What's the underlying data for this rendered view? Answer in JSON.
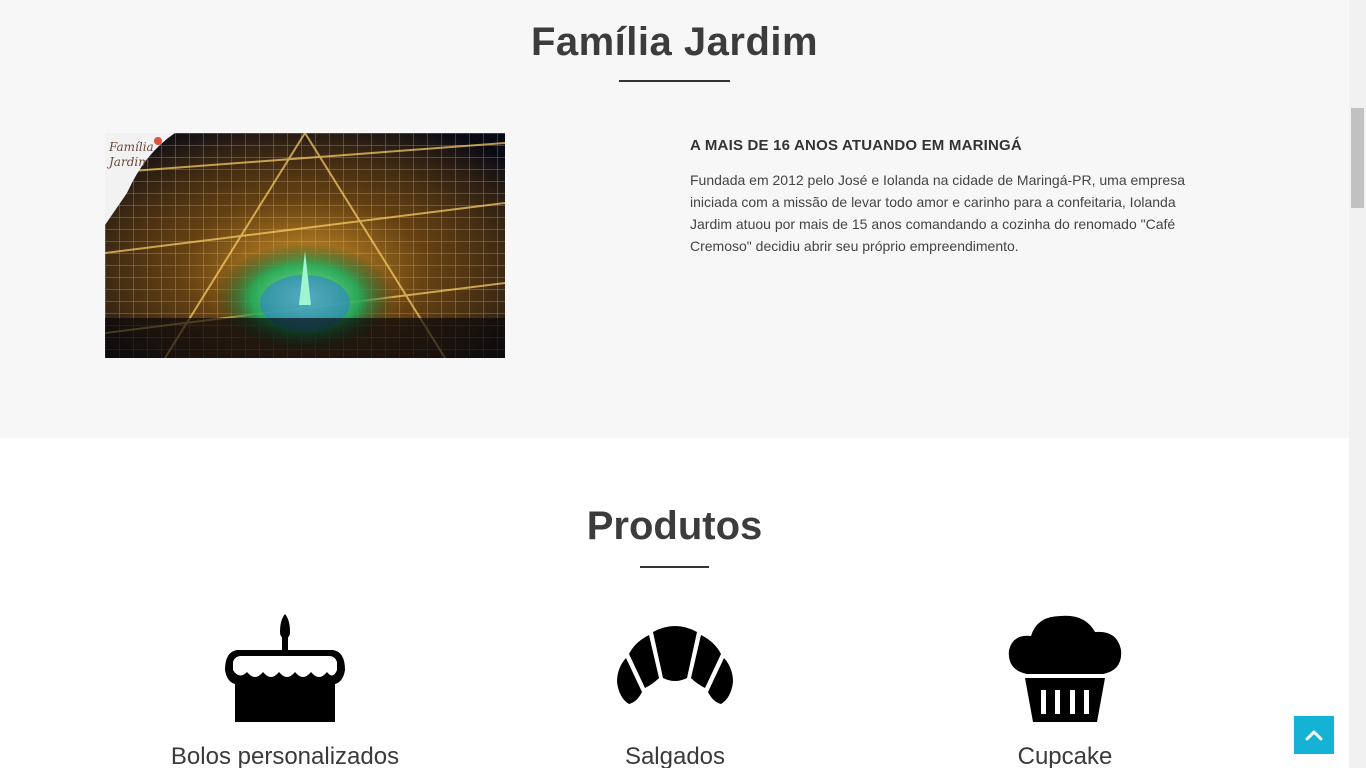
{
  "about": {
    "title": "Família Jardim",
    "subtitle": "A MAIS DE 16 ANOS ATUANDO EM MARINGÁ",
    "text": "Fundada em 2012 pelo José e Iolanda na cidade de Maringá-PR, uma empresa iniciada com a missão de levar todo amor e carinho para a confeitaria, Iolanda Jardim atuou por mais de 15 anos comandando a cozinha do renomado \"Café Cremoso\" decidiu abrir seu próprio empreendimento.",
    "photo_logo": "Família Jardim"
  },
  "products": {
    "title": "Produtos",
    "items": [
      {
        "label": "Bolos personalizados",
        "icon": "cake-icon"
      },
      {
        "label": "Salgados",
        "icon": "croissant-icon"
      },
      {
        "label": "Cupcake",
        "icon": "cupcake-icon"
      }
    ]
  },
  "colors": {
    "accent": "#14b2d5",
    "section_bg": "#f7f7f7",
    "heading": "#3c3c3c"
  },
  "icons": {
    "back_to_top": "chevron-up-icon"
  }
}
